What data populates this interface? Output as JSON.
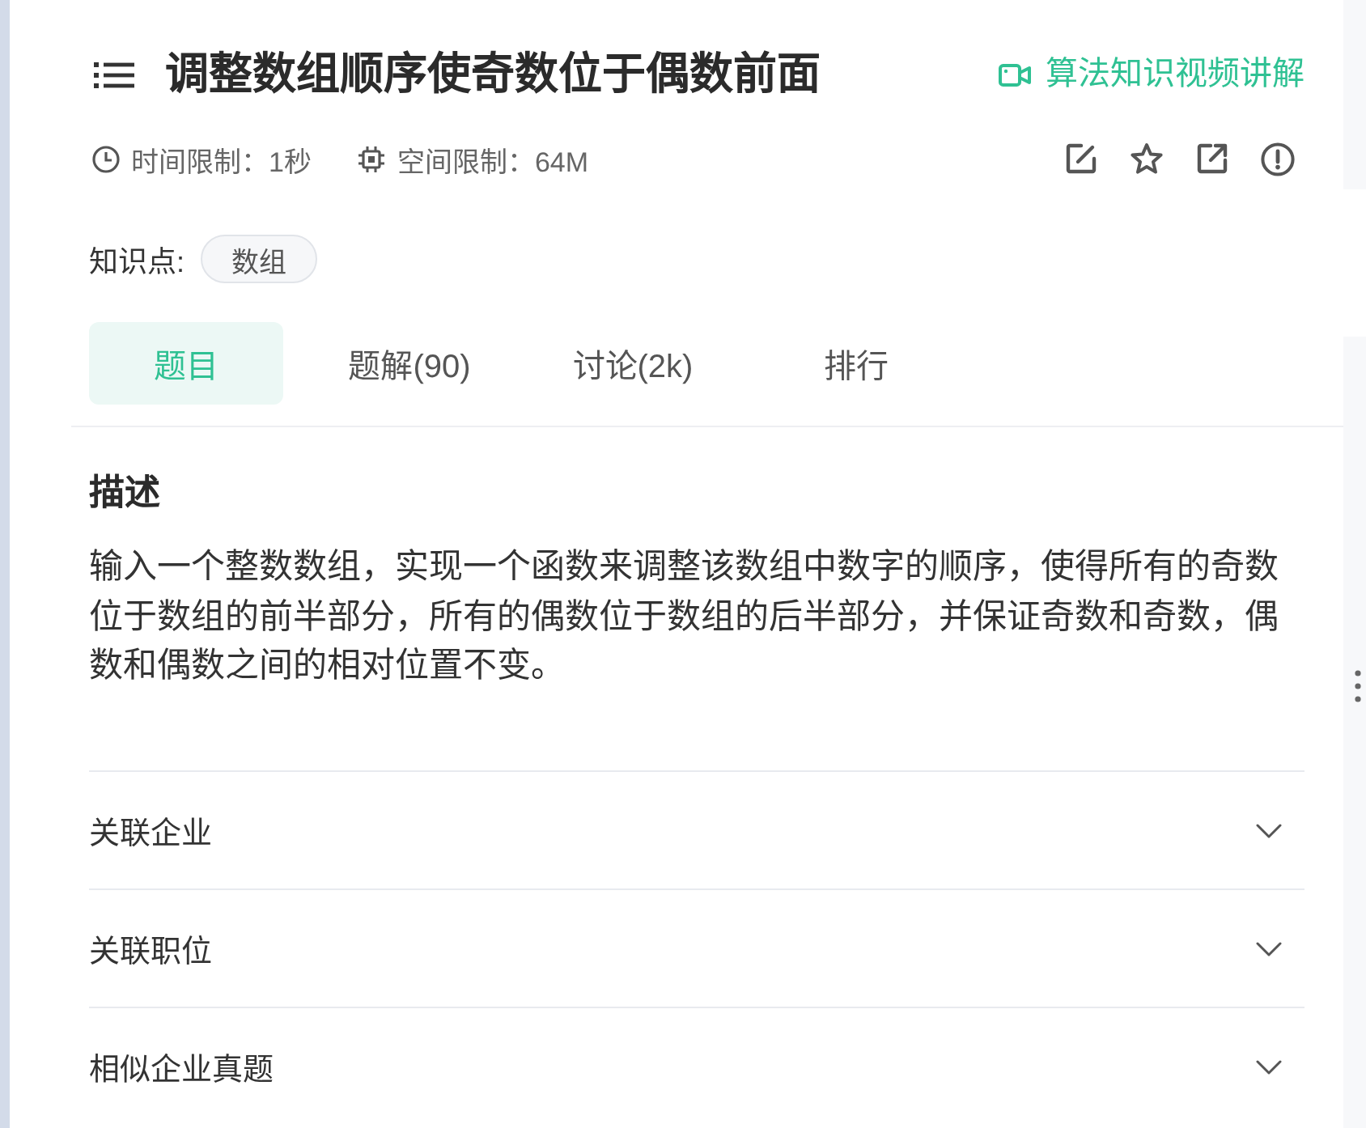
{
  "header": {
    "title": "调整数组顺序使奇数位于偶数前面",
    "video_link": "算法知识视频讲解"
  },
  "limits": [
    {
      "kind": "time",
      "text": "时间限制：1秒"
    },
    {
      "kind": "memory",
      "text": "空间限制：64M"
    }
  ],
  "knowledge": {
    "label": "知识点:",
    "tags": [
      "数组"
    ]
  },
  "tabs": [
    {
      "label": "题目",
      "selected": true
    },
    {
      "label": "题解(90)",
      "selected": false
    },
    {
      "label": "讨论(2k)",
      "selected": false
    },
    {
      "label": "排行",
      "selected": false
    }
  ],
  "description": {
    "heading": "描述",
    "text": "输入一个整数数组，实现一个函数来调整该数组中数字的顺序，使得所有的奇数位于数组的前半部分，所有的偶数位于数组的后半部分，并保证奇数和奇数，偶数和偶数之间的相对位置不变。"
  },
  "sections": [
    {
      "label": "关联企业",
      "expanded": false
    },
    {
      "label": "关联职位",
      "expanded": false
    },
    {
      "label": "相似企业真题",
      "expanded": false
    }
  ]
}
